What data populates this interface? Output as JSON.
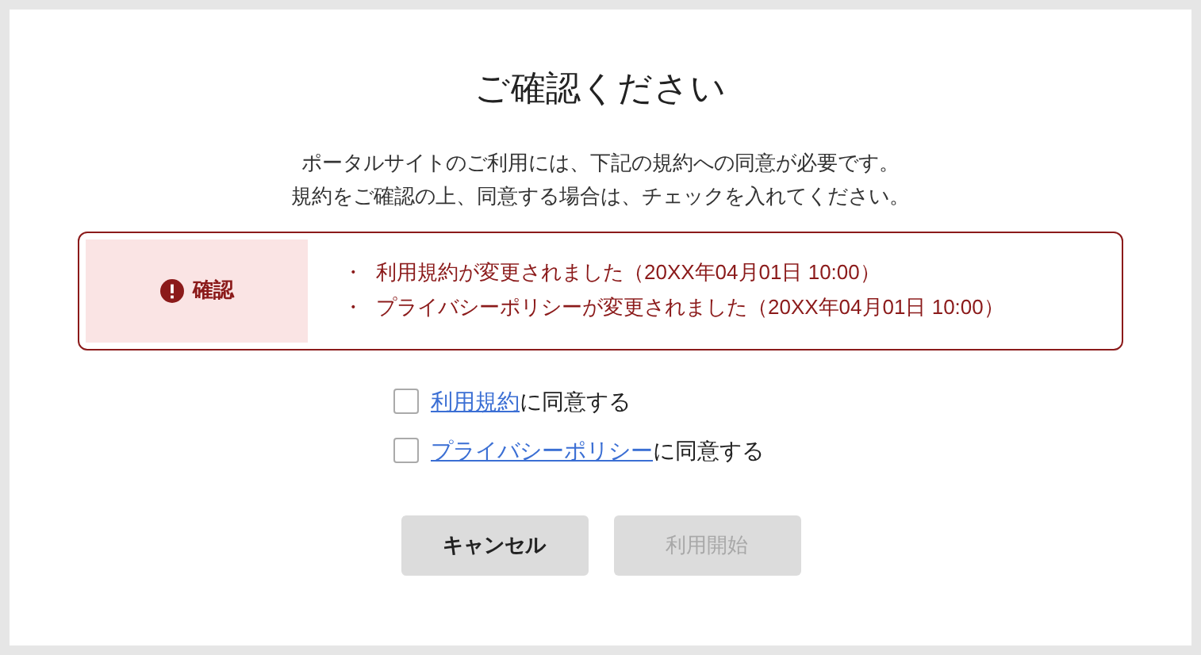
{
  "dialog": {
    "title": "ご確認ください",
    "message": [
      "ポータルサイトのご利用には、下記の規約への同意が必要です。",
      "規約をご確認の上、同意する場合は、チェックを入れてください。"
    ]
  },
  "notice": {
    "label": "確認",
    "items": [
      {
        "bullet": "・",
        "text": "利用規約が変更されました（20XX年04月01日 10:00）"
      },
      {
        "bullet": "・",
        "text": "プライバシーポリシーが変更されました（20XX年04月01日 10:00）"
      }
    ]
  },
  "agreements": [
    {
      "link": "利用規約",
      "suffix": "に同意する",
      "checked": false
    },
    {
      "link": "プライバシーポリシー",
      "suffix": "に同意する",
      "checked": false
    }
  ],
  "buttons": [
    {
      "label": "キャンセル",
      "disabled": false
    },
    {
      "label": "利用開始",
      "disabled": true
    }
  ]
}
